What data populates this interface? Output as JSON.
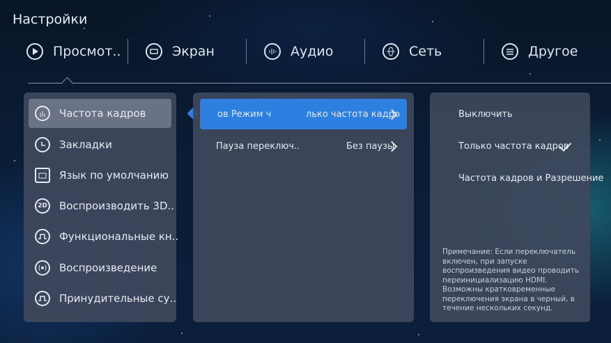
{
  "title": "Настройки",
  "tabs": [
    {
      "label": "Просмот..",
      "icon": "play-icon"
    },
    {
      "label": "Экран",
      "icon": "monitor-icon"
    },
    {
      "label": "Аудио",
      "icon": "audio-icon"
    },
    {
      "label": "Сеть",
      "icon": "globe-icon"
    },
    {
      "label": "Другое",
      "icon": "menu-icon"
    }
  ],
  "left_menu": [
    {
      "label": "Частота кадров",
      "icon": "frame-rate-icon",
      "selected": true
    },
    {
      "label": "Закладки",
      "icon": "clock-icon"
    },
    {
      "label": "Язык по умолчанию",
      "icon": "language-icon"
    },
    {
      "label": "Воспроизводить 3D..",
      "icon": "2d-icon",
      "icon_text": "2D"
    },
    {
      "label": "Функциональные кн..",
      "icon": "function-keys-icon"
    },
    {
      "label": "Воспроизведение",
      "icon": "playback-icon"
    },
    {
      "label": "Принудительные су..",
      "icon": "forced-subtitles-icon"
    }
  ],
  "middle": {
    "rows": [
      {
        "label": "ов       Режим ч",
        "value": "лько частота кадро",
        "active": true
      },
      {
        "label": "Пауза переключ..",
        "value": "Без паузы",
        "active": false
      }
    ]
  },
  "right": {
    "options": [
      {
        "label": "Выключить",
        "checked": false
      },
      {
        "label": "Только частота кадров",
        "checked": true
      },
      {
        "label": "Частота кадров и Разрешение",
        "checked": false
      }
    ],
    "note": "Примечание: Если переключатель включен, при запуске воспроизведения видео проводить переинициализацию HDMI. Возможны кратковременные переключения экрана в черный, в течение нескольких секунд."
  },
  "colors": {
    "accent": "#2d7fe0",
    "panel": "#3e485c",
    "selected": "#6a7385"
  }
}
